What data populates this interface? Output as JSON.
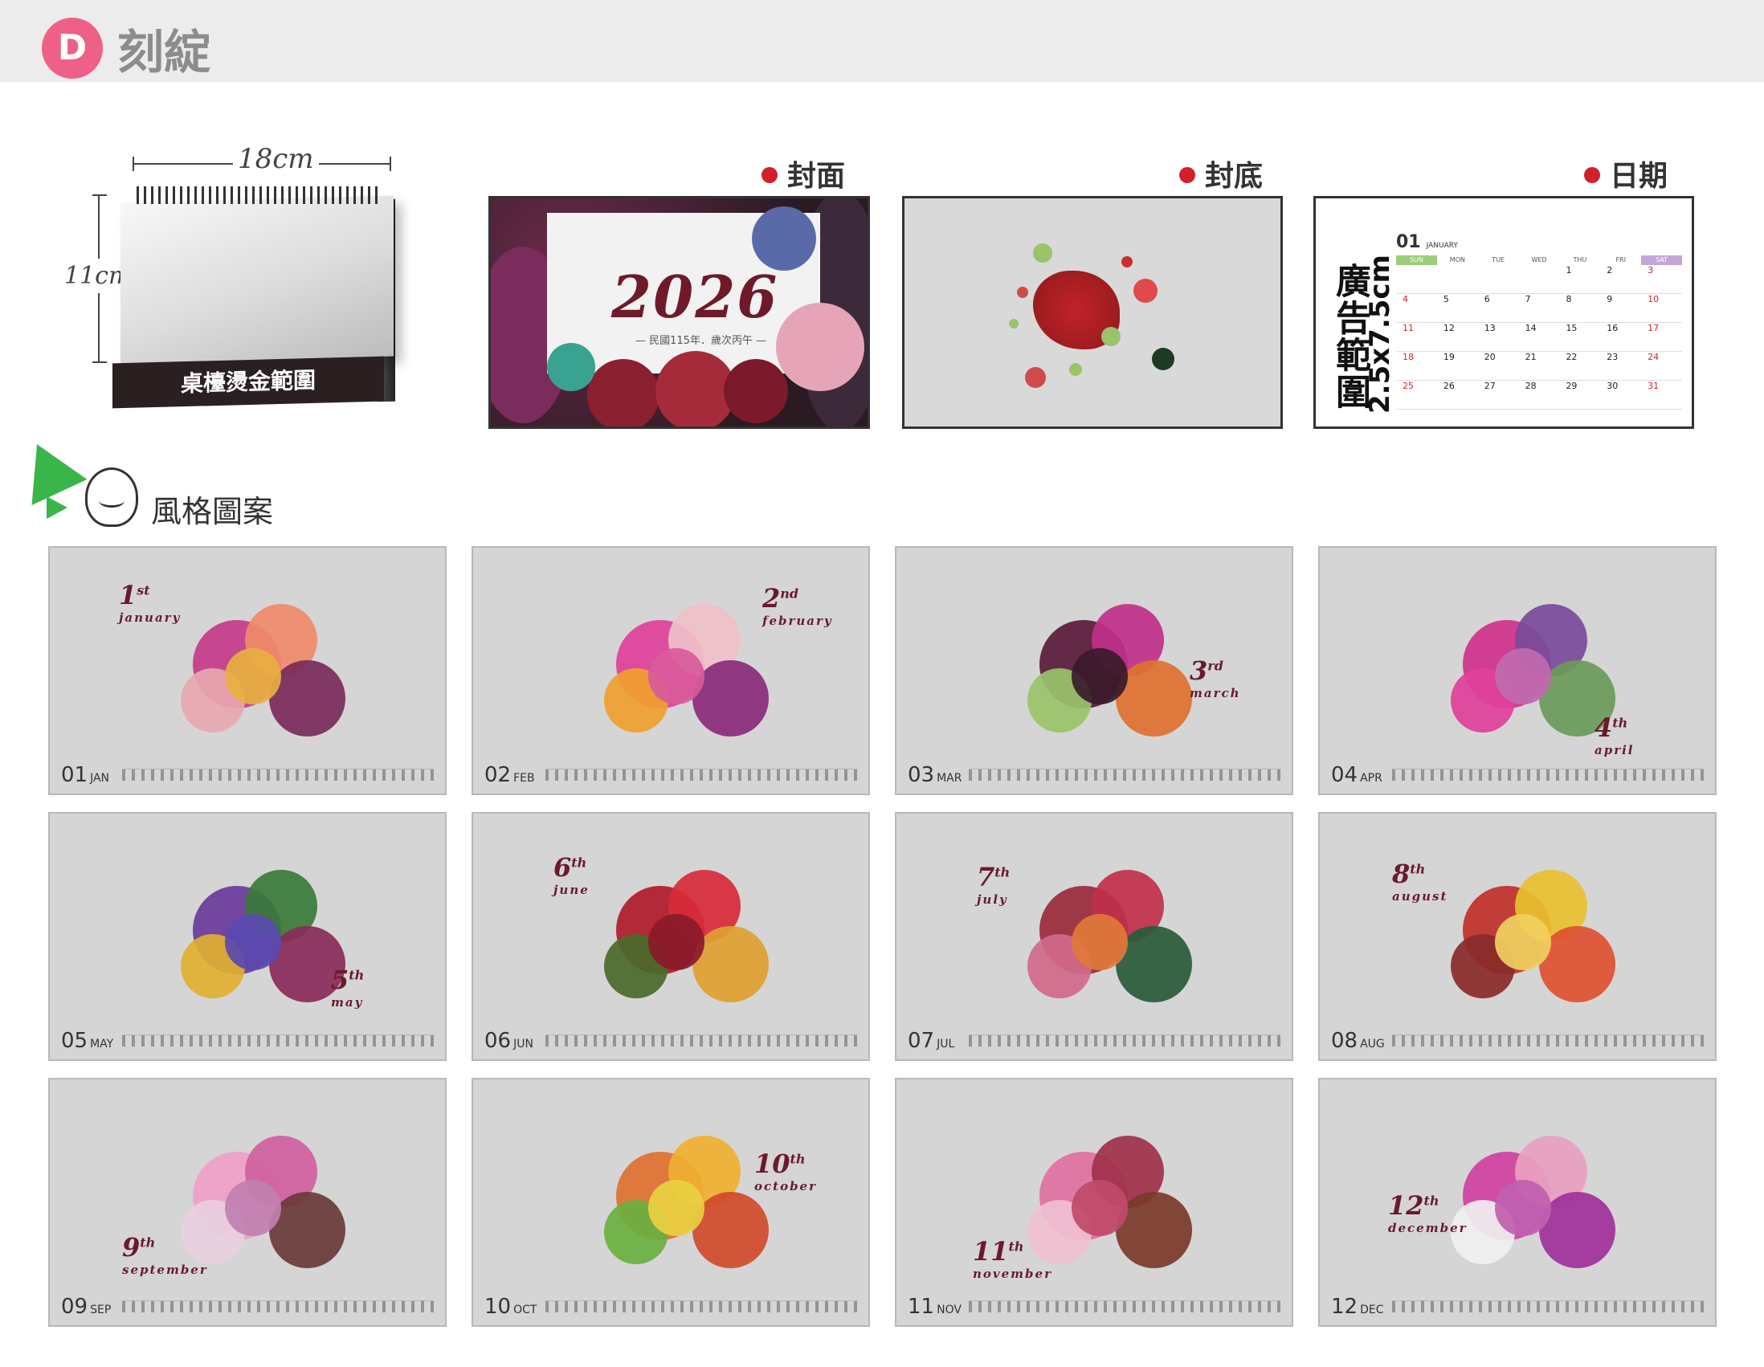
{
  "header": {
    "badge": "D",
    "title": "刻綻"
  },
  "product": {
    "width_label": "18cm",
    "height_label": "11cm",
    "foil_label": "桌檯燙金範圍"
  },
  "sections": {
    "cover": "封面",
    "back": "封底",
    "date": "日期"
  },
  "cover": {
    "year": "2026",
    "subtitle": "— 民國115年．歲次丙午 —"
  },
  "date_preview": {
    "ad_label": "廣告範圍",
    "ad_size": "2.5x7.5cm",
    "month_num": "01",
    "month_name": "JANUARY",
    "weekdays": [
      "SUN",
      "MON",
      "TUE",
      "WED",
      "THU",
      "FRI",
      "SAT"
    ],
    "weeks": [
      [
        "",
        "",
        "",
        "",
        "1",
        "2",
        "3"
      ],
      [
        "4",
        "5",
        "6",
        "7",
        "8",
        "9",
        "10"
      ],
      [
        "11",
        "12",
        "13",
        "14",
        "15",
        "16",
        "17"
      ],
      [
        "18",
        "19",
        "20",
        "21",
        "22",
        "23",
        "24"
      ],
      [
        "25",
        "26",
        "27",
        "28",
        "29",
        "30",
        "31"
      ]
    ]
  },
  "style_title": "風格圖案",
  "months": [
    {
      "num": "01",
      "abbr": "JAN",
      "ord": "1",
      "suffix": "st",
      "name": "january"
    },
    {
      "num": "02",
      "abbr": "FEB",
      "ord": "2",
      "suffix": "nd",
      "name": "february"
    },
    {
      "num": "03",
      "abbr": "MAR",
      "ord": "3",
      "suffix": "rd",
      "name": "march"
    },
    {
      "num": "04",
      "abbr": "APR",
      "ord": "4",
      "suffix": "th",
      "name": "april"
    },
    {
      "num": "05",
      "abbr": "MAY",
      "ord": "5",
      "suffix": "th",
      "name": "may"
    },
    {
      "num": "06",
      "abbr": "JUN",
      "ord": "6",
      "suffix": "th",
      "name": "june"
    },
    {
      "num": "07",
      "abbr": "JUL",
      "ord": "7",
      "suffix": "th",
      "name": "july"
    },
    {
      "num": "08",
      "abbr": "AUG",
      "ord": "8",
      "suffix": "th",
      "name": "august"
    },
    {
      "num": "09",
      "abbr": "SEP",
      "ord": "9",
      "suffix": "th",
      "name": "september"
    },
    {
      "num": "10",
      "abbr": "OCT",
      "ord": "10",
      "suffix": "th",
      "name": "october"
    },
    {
      "num": "11",
      "abbr": "NOV",
      "ord": "11",
      "suffix": "th",
      "name": "november"
    },
    {
      "num": "12",
      "abbr": "DEC",
      "ord": "12",
      "suffix": "th",
      "name": "december"
    }
  ],
  "colors": {
    "badge": "#ef6088",
    "accent_red": "#d21f2c",
    "maroon": "#6a1a2c",
    "card_bg": "#d5d5d5"
  }
}
